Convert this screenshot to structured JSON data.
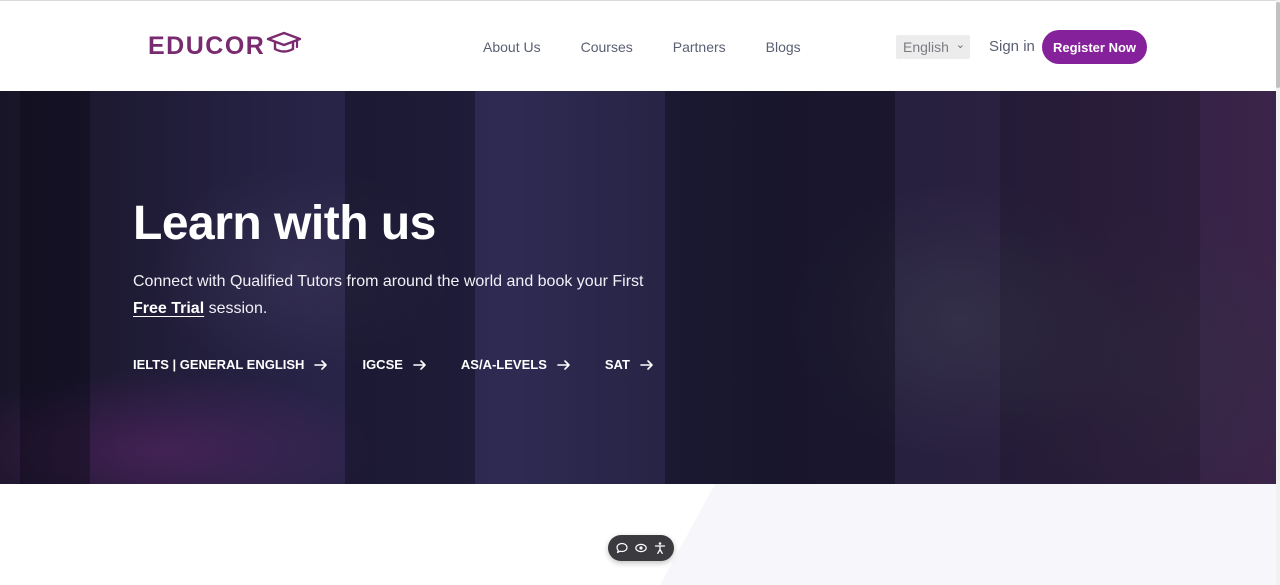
{
  "header": {
    "logo_text": "EDUCOR",
    "nav": [
      {
        "label": "About Us"
      },
      {
        "label": "Courses"
      },
      {
        "label": "Partners"
      },
      {
        "label": "Blogs"
      }
    ],
    "language": {
      "selected": "English"
    },
    "signin_label": "Sign in",
    "register_label": "Register Now"
  },
  "hero": {
    "title": "Learn with us",
    "subtitle_before": "Connect with Qualified Tutors from around the world and book your First ",
    "subtitle_link": "Free Trial",
    "subtitle_after": " session.",
    "courses": [
      {
        "label": "IELTS | GENERAL ENGLISH"
      },
      {
        "label": "IGCSE"
      },
      {
        "label": "AS/A-LEVELS"
      },
      {
        "label": "SAT"
      }
    ]
  },
  "toolbar": {
    "icons": [
      "chat-bubble-icon",
      "eye-icon",
      "accessibility-icon"
    ]
  },
  "colors": {
    "brand": "#7a2a6f",
    "accent_button": "#85219a",
    "nav_text": "#5a5f73",
    "hero_bg": "#2e2a52"
  }
}
